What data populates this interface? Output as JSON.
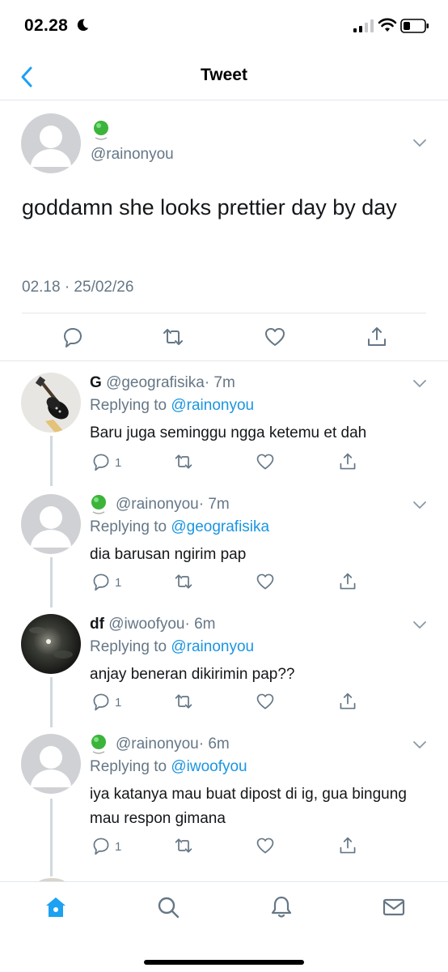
{
  "status_bar": {
    "time": "02.28"
  },
  "nav": {
    "title": "Tweet"
  },
  "main_tweet": {
    "handle": "@rainonyou",
    "text": "goddamn she looks prettier day by day",
    "timestamp": "02.18 · 25/02/26",
    "actions": [
      "reply-icon",
      "retweet-icon",
      "like-icon",
      "share-icon"
    ]
  },
  "replies": [
    {
      "name": "G",
      "handle": "@geografisika",
      "time": "· 7m",
      "replying_label": "Replying to",
      "replying_to": "@rainonyou",
      "text": "Baru juga seminggu ngga ketemu et dah",
      "reply_count": "1"
    },
    {
      "name": "",
      "handle": "@rainonyou",
      "time": "· 7m",
      "replying_label": "Replying to",
      "replying_to": "@geografisika",
      "text": "dia barusan ngirim pap",
      "reply_count": "1"
    },
    {
      "name": "df",
      "handle": "@iwoofyou",
      "time": "· 6m",
      "replying_label": "Replying to",
      "replying_to": "@rainonyou",
      "text": "anjay beneran dikirimin pap??",
      "reply_count": "1"
    },
    {
      "name": "",
      "handle": "@rainonyou",
      "time": "· 6m",
      "replying_label": "Replying to",
      "replying_to": "@iwoofyou",
      "text": "iya katanya mau buat dipost di ig, gua bingung mau respon gimana",
      "reply_count": "1"
    }
  ],
  "tab_bar": {
    "tabs": [
      "home-icon",
      "search-icon",
      "notifications-icon",
      "messages-icon"
    ],
    "active": "home-icon"
  },
  "colors": {
    "accent": "#1da1f2",
    "mention": "#1b95e0",
    "secondary_text": "#657786",
    "divider": "#e1e8ed"
  }
}
